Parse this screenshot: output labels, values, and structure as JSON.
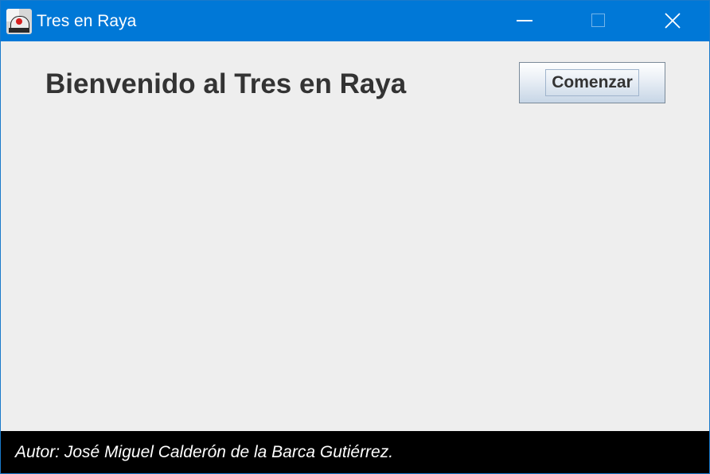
{
  "window": {
    "title": "Tres en Raya",
    "icon": "app-icon",
    "controls": {
      "minimize_icon": "minimize-icon",
      "maximize_icon": "maximize-icon",
      "close_icon": "close-icon"
    }
  },
  "main": {
    "heading": "Bienvenido al Tres en Raya",
    "start_button_label": "Comenzar"
  },
  "footer": {
    "author": "Autor: José Miguel Calderón de la Barca Gutiérrez."
  },
  "colors": {
    "titlebar": "#0078d7",
    "content_background": "#eeeeee",
    "heading_text": "#333333",
    "footer_background": "#000000",
    "footer_text": "#ffffff"
  }
}
